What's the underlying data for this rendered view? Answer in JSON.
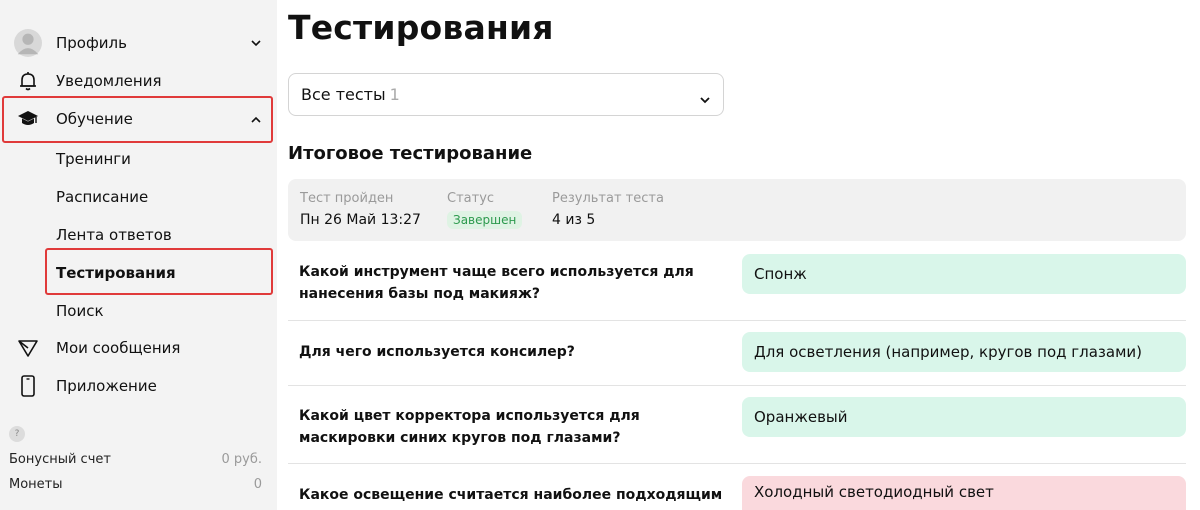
{
  "sidebar": {
    "profile_label": "Профиль",
    "notifications_label": "Уведомления",
    "learning_label": "Обучение",
    "learning_sub": {
      "trainings": "Тренинги",
      "schedule": "Расписание",
      "answers_feed": "Лента ответов",
      "testing": "Тестирования",
      "search": "Поиск"
    },
    "messages_label": "Мои сообщения",
    "app_label": "Приложение",
    "help_icon_text": "?",
    "bonus_label": "Бонусный счет",
    "bonus_value": "0 руб.",
    "coins_label": "Монеты",
    "coins_value": "0"
  },
  "main": {
    "title": "Тестирования",
    "filter": {
      "selected": "Все тесты",
      "count": "1"
    },
    "section_title": "Итоговое тестирование",
    "summary": {
      "passed_label": "Тест пройден",
      "passed_value": "Пн 26 Май 13:27",
      "status_label": "Статус",
      "status_value": "Завершен",
      "result_label": "Результат теста",
      "result_value": "4 из 5"
    },
    "questions": [
      {
        "q": "Какой инструмент чаще всего используется для нанесения базы под макияж?",
        "a": "Спонж",
        "state": "correct"
      },
      {
        "q": "Для чего используется консилер?",
        "a": "Для осветления (например, кругов под глазами)",
        "state": "correct"
      },
      {
        "q": "Какой цвет корректора используется для маскировки синих кругов под глазами?",
        "a": "Оранжевый",
        "state": "correct"
      },
      {
        "q": "Какое освещение считается наиболее подходящим",
        "a": "Холодный светодиодный свет",
        "state": "wrong"
      }
    ]
  },
  "colors": {
    "highlight": "#e03a3a",
    "status_green": "#2d9a4e",
    "correct_bg": "#d9f6ea",
    "wrong_bg": "#fad9dd"
  },
  "icons": {
    "profile": "avatar-icon",
    "notifications": "bell-icon",
    "learning": "graduation-cap-icon",
    "messages": "send-icon",
    "app": "phone-icon",
    "expand": "chevron-down-icon",
    "collapse": "chevron-up-icon"
  }
}
